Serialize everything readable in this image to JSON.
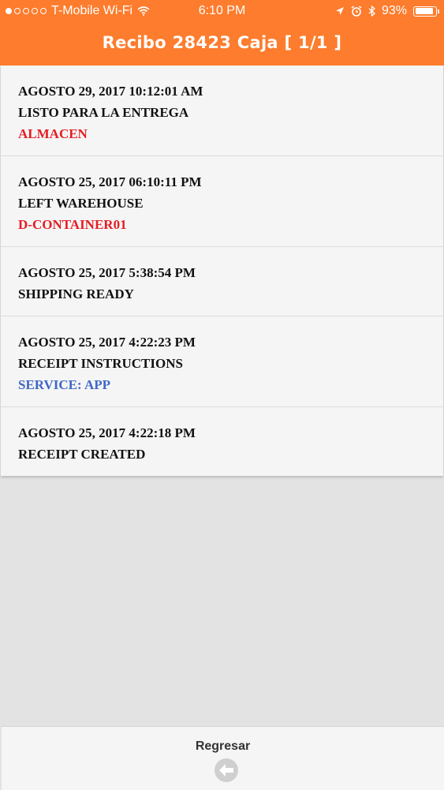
{
  "status_bar": {
    "carrier": "T-Mobile Wi-Fi",
    "time": "6:10 PM",
    "battery": "93%",
    "battery_level": 0.93
  },
  "header": {
    "title": "Recibo 28423 Caja [ 1/1 ]"
  },
  "events": [
    {
      "date": "AGOSTO 29, 2017 10:12:01 AM",
      "status": "LISTO PARA LA ENTREGA",
      "location": "ALMACEN",
      "location_color": "#e51c23"
    },
    {
      "date": "AGOSTO 25, 2017 06:10:11 PM",
      "status": "LEFT WAREHOUSE",
      "location": "D-CONTAINER01",
      "location_color": "#e51c23"
    },
    {
      "date": "AGOSTO 25, 2017 5:38:54 PM",
      "status": "SHIPPING READY"
    },
    {
      "date": "AGOSTO 25, 2017 4:22:23 PM",
      "status": "RECEIPT INSTRUCTIONS",
      "location": "SERVICE: APP",
      "location_color": "#3f67c6"
    },
    {
      "date": "AGOSTO 25, 2017 4:22:18 PM",
      "status": "RECEIPT CREATED"
    }
  ],
  "footer": {
    "back_label": "Regresar"
  },
  "colors": {
    "accent": "#fd7c2d",
    "background": "#e3e3e3"
  }
}
